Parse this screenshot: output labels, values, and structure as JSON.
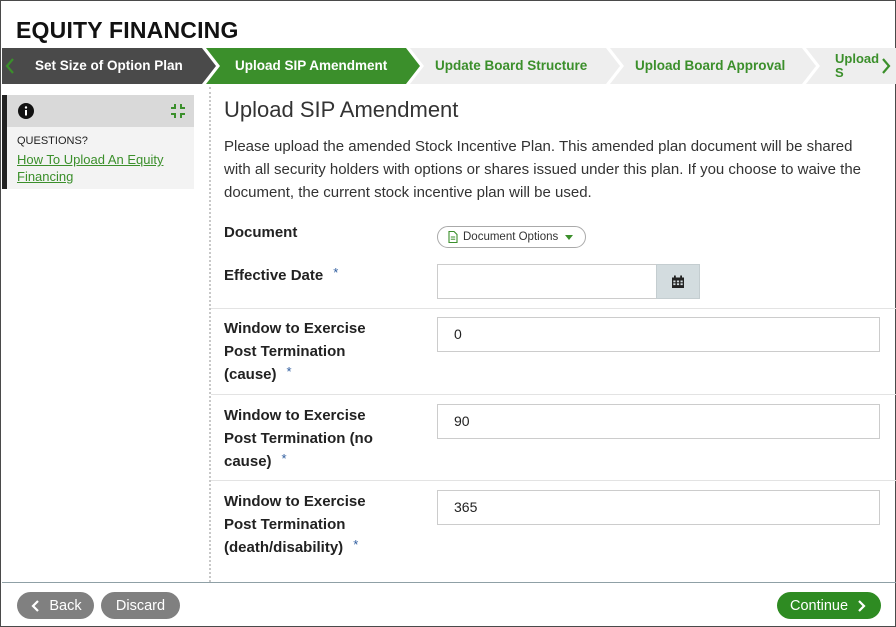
{
  "page": {
    "title": "EQUITY FINANCING"
  },
  "wizard": {
    "steps": [
      {
        "label": "Set Size of Option Plan",
        "state": "done"
      },
      {
        "label": "Upload SIP Amendment",
        "state": "active"
      },
      {
        "label": "Update Board Structure",
        "state": "future"
      },
      {
        "label": "Upload Board Approval",
        "state": "future"
      },
      {
        "label": "Upload S Approva",
        "state": "future"
      }
    ],
    "colors": {
      "done": "#4a4a4a",
      "active": "#3b8f2b",
      "future": "#eeeeee"
    },
    "prev_icon": "chevron-left-icon",
    "next_icon": "chevron-right-icon"
  },
  "sidebar": {
    "info_icon": "info-icon",
    "collapse_icon": "compress-icon",
    "questions_label": "QUESTIONS?",
    "help_link": "How To Upload An Equity Financing"
  },
  "main": {
    "heading": "Upload SIP Amendment",
    "intro": "Please upload the amended Stock Incentive Plan. This amended plan document will be shared with all security holders with options or shares issued under this plan. If you choose to waive the document, the current stock incentive plan will be used.",
    "fields": {
      "document": {
        "label": "Document",
        "button": "Document Options",
        "icon": "file-icon"
      },
      "effective_date": {
        "label": "Effective Date",
        "required": "*",
        "value": "",
        "icon": "calendar-icon"
      },
      "window_cause": {
        "label": "Window to Exercise Post Termination (cause)",
        "required": "*",
        "value": "0"
      },
      "window_no_cause": {
        "label": "Window to Exercise Post Termination (no cause)",
        "required": "*",
        "value": "90"
      },
      "window_death": {
        "label": "Window to Exercise Post Termination (death/disability)",
        "required": "*",
        "value": "365"
      }
    }
  },
  "footer": {
    "back": "Back",
    "discard": "Discard",
    "continue": "Continue",
    "accent": "#2e8b22"
  }
}
